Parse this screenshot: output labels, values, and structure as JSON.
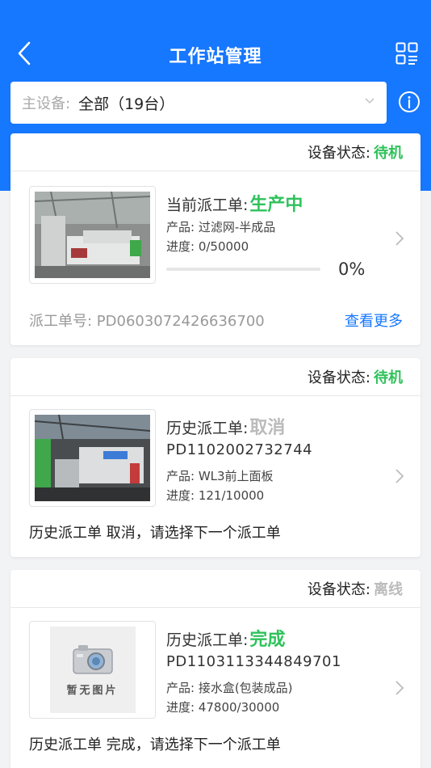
{
  "colors": {
    "primary": "#1677ff",
    "green": "#2fc25b",
    "gray": "#bbbbbb"
  },
  "header": {
    "title": "工作站管理",
    "back_icon": "chevron-left-icon",
    "right_icon": "qr-scan-icon"
  },
  "filter": {
    "label": "主设备:",
    "value": "全部（19台）",
    "info_icon": "info-circle-icon"
  },
  "cards": [
    {
      "status_label": "设备状态:",
      "status_value": "待机",
      "status_color": "#2fc25b",
      "order_label": "当前派工单:",
      "order_state": "生产中",
      "order_state_color": "#2fc25b",
      "product": "产品: 过滤网-半成品",
      "progress_text": "进度: 0/50000",
      "progress": 0,
      "progress_pct": "0%",
      "order_number": "派工单号: PD0603072426636700",
      "more_link": "查看更多"
    },
    {
      "status_label": "设备状态:",
      "status_value": "待机",
      "status_color": "#2fc25b",
      "order_label": "历史派工单:",
      "order_state": "取消",
      "order_state_color": "#bbbbbb",
      "order_id": "PD1102002732744",
      "product": "产品: WL3前上面板",
      "progress_text": "进度: 121/10000",
      "message": "历史派工单 取消，请选择下一个派工单"
    },
    {
      "status_label": "设备状态:",
      "status_value": "离线",
      "status_color": "#bbbbbb",
      "order_label": "历史派工单:",
      "order_state": "完成",
      "order_state_color": "#2fc25b",
      "order_id": "PD1103113344849701",
      "product": "产品: 接水盒(包装成品)",
      "progress_text": "进度: 47800/30000",
      "no_image_text": "暂无图片",
      "message": "历史派工单 完成，请选择下一个派工单"
    }
  ]
}
